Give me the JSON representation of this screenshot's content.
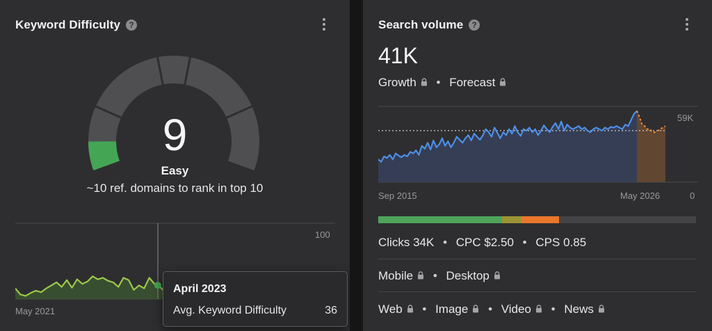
{
  "keyword_difficulty": {
    "title": "Keyword Difficulty",
    "help_icon": "?",
    "score": "9",
    "level": "Easy",
    "subtitle": "~10 ref. domains to rank in top 10",
    "gauge_value_fraction": 0.09,
    "chart": {
      "y_max_label": "100",
      "x_start_label": "May 2021",
      "values": [
        14,
        6,
        4,
        8,
        11,
        9,
        14,
        18,
        22,
        16,
        25,
        15,
        26,
        20,
        23,
        30,
        26,
        28,
        24,
        22,
        16,
        28,
        25,
        12,
        18,
        14,
        28,
        20,
        17,
        9,
        12,
        8,
        20,
        25,
        12,
        20,
        31,
        22,
        24,
        14,
        20,
        14,
        12,
        11,
        16,
        10,
        14,
        18,
        12,
        10,
        16,
        21,
        25,
        22,
        28,
        30,
        30
      ],
      "tooltip": {
        "title": "April 2023",
        "label": "Avg. Keyword Difficulty",
        "value": "36"
      }
    }
  },
  "search_volume": {
    "title": "Search volume",
    "help_icon": "?",
    "value": "41K",
    "growth_label": "Growth",
    "forecast_label": "Forecast",
    "chart": {
      "y_max_label": "59K",
      "y_min_label": "0",
      "x_start_label": "Sep 2015",
      "x_end_label": "May 2026",
      "history": [
        30,
        27,
        34,
        32,
        36,
        30,
        38,
        35,
        33,
        36,
        34,
        40,
        38,
        42,
        36,
        48,
        44,
        52,
        43,
        55,
        46,
        50,
        58,
        48,
        54,
        46,
        52,
        60,
        56,
        52,
        58,
        62,
        55,
        64,
        60,
        56,
        62,
        70,
        66,
        60,
        72,
        65,
        58,
        66,
        62,
        70,
        64,
        74,
        66,
        61,
        70,
        68,
        72,
        66,
        70,
        62,
        68,
        75,
        70,
        66,
        73,
        78,
        70,
        80,
        68,
        76,
        72,
        70,
        72,
        74,
        70,
        72,
        68,
        66,
        70,
        72,
        70,
        68,
        72,
        70,
        73,
        72,
        74,
        72,
        70,
        76,
        74,
        82,
        90,
        94
      ],
      "forecast": [
        94,
        86,
        76,
        74,
        70,
        70,
        66,
        66,
        68,
        70,
        72,
        74
      ],
      "colors": {
        "history_line": "#4d8fe8",
        "forecast_line": "#f0862e",
        "forecast_fill": "#6a4a32"
      }
    },
    "traffic_bar": [
      {
        "color": "#4ea45a",
        "fraction": 0.39
      },
      {
        "color": "#9c9334",
        "fraction": 0.06
      },
      {
        "color": "#e9772c",
        "fraction": 0.12
      },
      {
        "color": "#444447",
        "fraction": 0.43
      }
    ],
    "stats": [
      {
        "label": "Clicks",
        "value": "34K"
      },
      {
        "label": "CPC",
        "value": "$2.50"
      },
      {
        "label": "CPS",
        "value": "0.85"
      }
    ],
    "devices": [
      "Mobile",
      "Desktop"
    ],
    "serp_types": [
      "Web",
      "Image",
      "Video",
      "News"
    ]
  }
}
